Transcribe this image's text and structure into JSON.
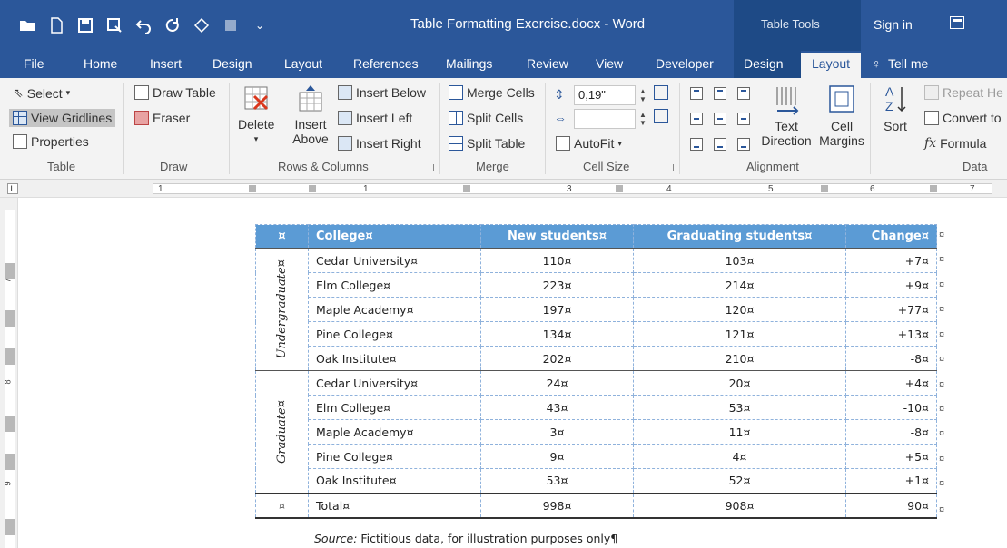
{
  "window": {
    "title": "Table Formatting Exercise.docx - Word",
    "context_tab_group": "Table Tools",
    "sign_in": "Sign in"
  },
  "tabs": [
    "File",
    "Home",
    "Insert",
    "Design",
    "Layout",
    "References",
    "Mailings",
    "Review",
    "View",
    "Developer",
    "Design",
    "Layout",
    "Tell me"
  ],
  "active_tab": "Layout",
  "ribbon": {
    "table": {
      "select": "Select",
      "view_gridlines": "View Gridlines",
      "properties": "Properties",
      "label": "Table"
    },
    "draw": {
      "draw_table": "Draw Table",
      "eraser": "Eraser",
      "label": "Draw"
    },
    "rows_columns": {
      "delete": "Delete",
      "insert_above_1": "Insert",
      "insert_above_2": "Above",
      "insert_below": "Insert Below",
      "insert_left": "Insert Left",
      "insert_right": "Insert Right",
      "label": "Rows & Columns"
    },
    "merge": {
      "merge_cells": "Merge Cells",
      "split_cells": "Split Cells",
      "split_table": "Split Table",
      "label": "Merge"
    },
    "cell_size": {
      "height_value": "0,19\"",
      "width_value": "",
      "autofit": "AutoFit",
      "label": "Cell Size"
    },
    "alignment": {
      "text_direction_1": "Text",
      "text_direction_2": "Direction",
      "cell_margins_1": "Cell",
      "cell_margins_2": "Margins",
      "label": "Alignment"
    },
    "data": {
      "sort": "Sort",
      "repeat_header": "Repeat He",
      "convert": "Convert to",
      "formula": "Formula",
      "label": "Data"
    }
  },
  "ruler": {
    "numbers": [
      "1",
      "1",
      "2",
      "3",
      "4",
      "5",
      "6",
      "7"
    ]
  },
  "vruler": {
    "numbers": [
      "7",
      "8",
      "9"
    ]
  },
  "table": {
    "headers": [
      "¤",
      "College¤",
      "New students¤",
      "Graduating students¤",
      "Change¤"
    ],
    "groups": [
      {
        "label": "Undergraduate¤",
        "rows": [
          [
            "Cedar University¤",
            "110¤",
            "103¤",
            "+7¤"
          ],
          [
            "Elm College¤",
            "223¤",
            "214¤",
            "+9¤"
          ],
          [
            "Maple Academy¤",
            "197¤",
            "120¤",
            "+77¤"
          ],
          [
            "Pine College¤",
            "134¤",
            "121¤",
            "+13¤"
          ],
          [
            "Oak Institute¤",
            "202¤",
            "210¤",
            "-8¤"
          ]
        ]
      },
      {
        "label": "Graduate¤",
        "rows": [
          [
            "Cedar University¤",
            "24¤",
            "20¤",
            "+4¤"
          ],
          [
            "Elm College¤",
            "43¤",
            "53¤",
            "-10¤"
          ],
          [
            "Maple Academy¤",
            "3¤",
            "11¤",
            "-8¤"
          ],
          [
            "Pine College¤",
            "9¤",
            "4¤",
            "+5¤"
          ],
          [
            "Oak Institute¤",
            "53¤",
            "52¤",
            "+1¤"
          ]
        ]
      }
    ],
    "total": [
      "¤",
      "Total¤",
      "998¤",
      "908¤",
      "90¤"
    ],
    "row_end_mark": "¤"
  },
  "source": {
    "label": "Source:",
    "text": " Fictitious data, for illustration purposes only¶"
  },
  "colors": {
    "title_bar": "#2b579a",
    "context_band": "#1e4a86",
    "header_fill": "#5b9bd5"
  }
}
